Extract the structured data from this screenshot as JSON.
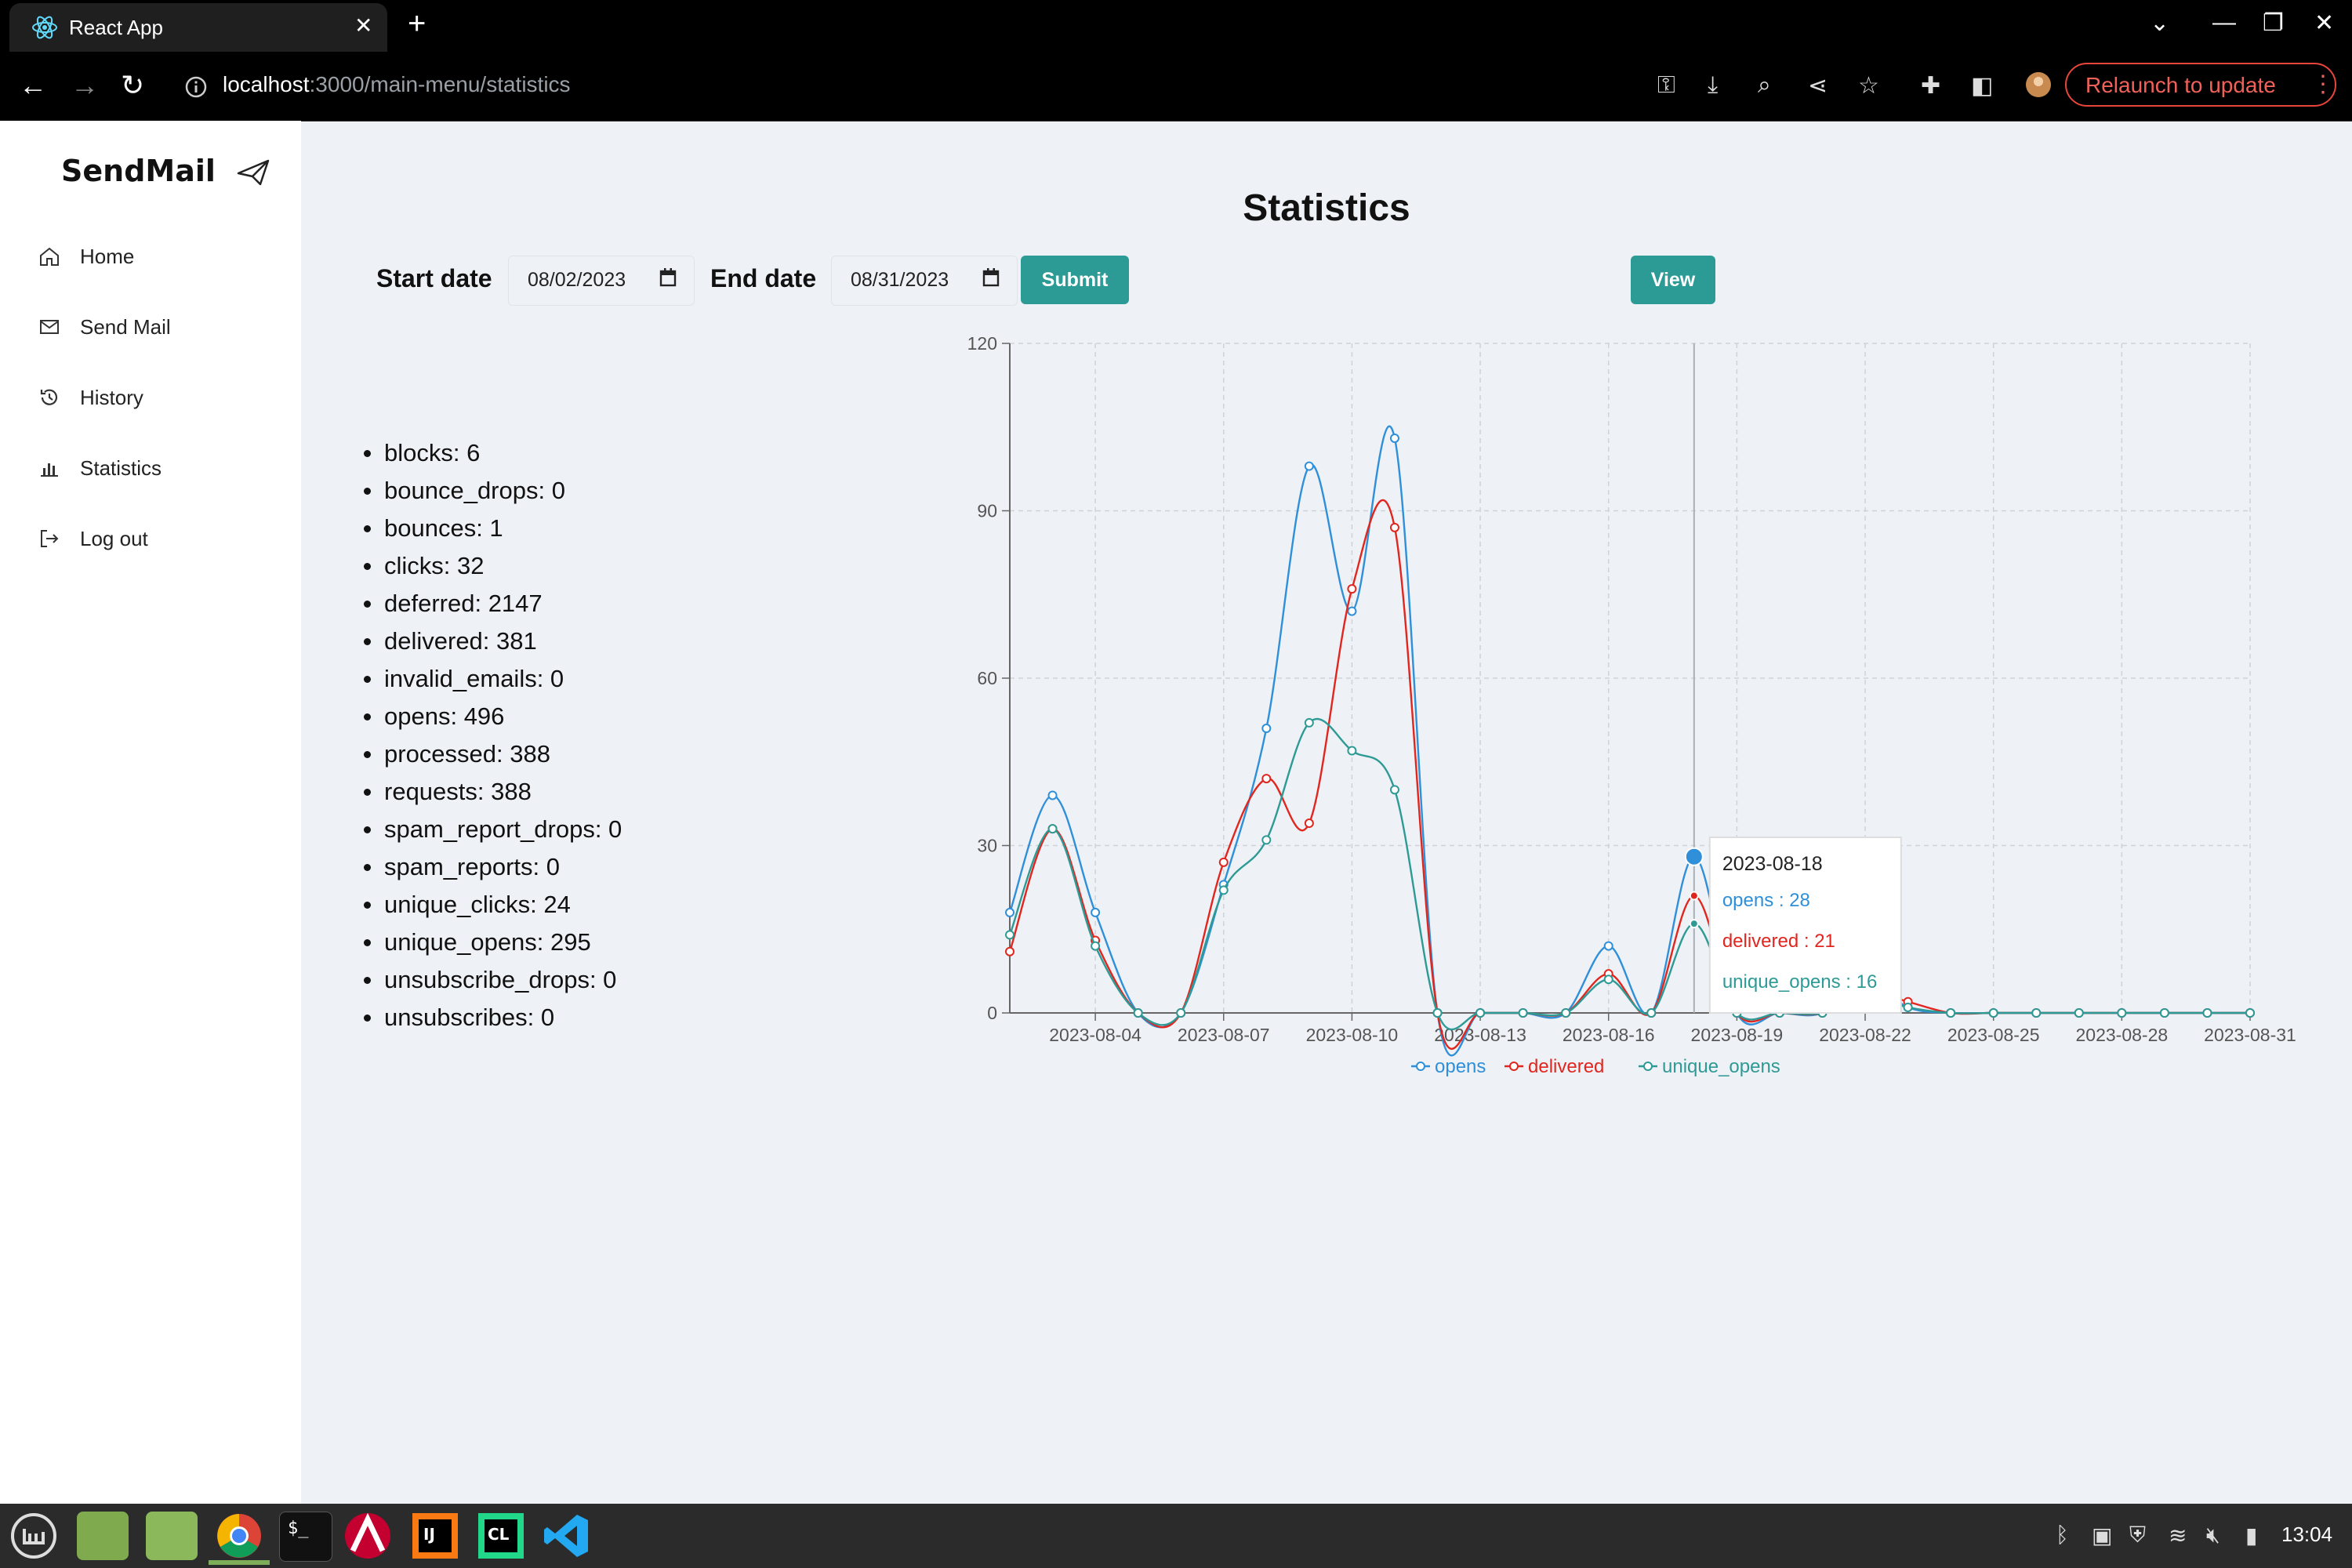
{
  "browser": {
    "tab_title": "React App",
    "url_host": "localhost",
    "url_path": ":3000/main-menu/statistics",
    "relaunch_label": "Relaunch to update"
  },
  "sidebar": {
    "brand": "SendMail",
    "items": [
      {
        "label": "Home",
        "icon": "home-icon"
      },
      {
        "label": "Send Mail",
        "icon": "mail-icon"
      },
      {
        "label": "History",
        "icon": "history-icon"
      },
      {
        "label": "Statistics",
        "icon": "bar-chart-icon"
      },
      {
        "label": "Log out",
        "icon": "logout-icon"
      }
    ]
  },
  "page": {
    "title": "Statistics",
    "start_label": "Start date",
    "start_value": "08/02/2023",
    "end_label": "End date",
    "end_value": "08/31/2023",
    "submit_label": "Submit",
    "view_label": "View"
  },
  "stats": [
    "blocks: 6",
    "bounce_drops: 0",
    "bounces: 1",
    "clicks: 32",
    "deferred: 2147",
    "delivered: 381",
    "invalid_emails: 0",
    "opens: 496",
    "processed: 388",
    "requests: 388",
    "spam_report_drops: 0",
    "spam_reports: 0",
    "unique_clicks: 24",
    "unique_opens: 295",
    "unsubscribe_drops: 0",
    "unsubscribes: 0"
  ],
  "chart_data": {
    "type": "line",
    "x": [
      "2023-08-02",
      "2023-08-03",
      "2023-08-04",
      "2023-08-05",
      "2023-08-06",
      "2023-08-07",
      "2023-08-08",
      "2023-08-09",
      "2023-08-10",
      "2023-08-11",
      "2023-08-12",
      "2023-08-13",
      "2023-08-14",
      "2023-08-15",
      "2023-08-16",
      "2023-08-17",
      "2023-08-18",
      "2023-08-19",
      "2023-08-20",
      "2023-08-21",
      "2023-08-22",
      "2023-08-23",
      "2023-08-24",
      "2023-08-25",
      "2023-08-26",
      "2023-08-27",
      "2023-08-28",
      "2023-08-29",
      "2023-08-30",
      "2023-08-31"
    ],
    "x_ticks": [
      "2023-08-04",
      "2023-08-07",
      "2023-08-10",
      "2023-08-13",
      "2023-08-16",
      "2023-08-19",
      "2023-08-22",
      "2023-08-25",
      "2023-08-28",
      "2023-08-31"
    ],
    "ylim": [
      0,
      120
    ],
    "y_ticks": [
      0,
      30,
      60,
      90,
      120
    ],
    "grid": true,
    "legend": "bottom",
    "series": [
      {
        "name": "opens",
        "color": "#2f8fd9",
        "values": [
          18,
          39,
          18,
          0,
          0,
          23,
          51,
          98,
          72,
          103,
          0,
          0,
          0,
          0,
          12,
          0,
          28,
          0,
          0,
          0,
          6,
          1,
          0,
          0,
          0,
          0,
          0,
          0,
          0,
          0
        ]
      },
      {
        "name": "delivered",
        "color": "#e0261f",
        "values": [
          11,
          33,
          13,
          0,
          0,
          27,
          42,
          34,
          76,
          87,
          0,
          0,
          0,
          0,
          7,
          0,
          21,
          0,
          0,
          0,
          4,
          2,
          0,
          0,
          0,
          0,
          0,
          0,
          0,
          0
        ]
      },
      {
        "name": "unique_opens",
        "color": "#2e9a95",
        "values": [
          14,
          33,
          12,
          0,
          0,
          22,
          31,
          52,
          47,
          40,
          0,
          0,
          0,
          0,
          6,
          0,
          16,
          0,
          0,
          0,
          3,
          1,
          0,
          0,
          0,
          0,
          0,
          0,
          0,
          0
        ]
      }
    ],
    "tooltip": {
      "date": "2023-08-18",
      "lines": [
        "opens : 28",
        "delivered : 21",
        "unique_opens : 16"
      ]
    }
  },
  "taskbar": {
    "clock": "13:04"
  }
}
